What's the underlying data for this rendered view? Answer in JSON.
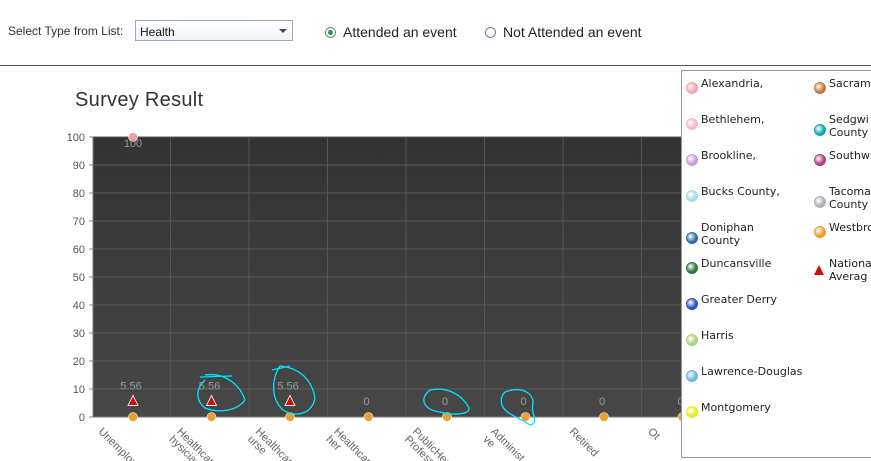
{
  "controls": {
    "select_label": "Select Type from List:",
    "select_value": "Health",
    "radio_attended": "Attended an event",
    "radio_not_attended": "Not Attended an event"
  },
  "chart_data": {
    "type": "scatter",
    "title": "Survey Result",
    "ylim": [
      0,
      100
    ],
    "yticks": [
      0,
      10,
      20,
      30,
      40,
      50,
      60,
      70,
      80,
      90,
      100
    ],
    "categories": [
      "Unemploye",
      "Healthcare Physician",
      "Healthcare Nurse",
      "Healthcare Other",
      "Public Health Professi",
      "Administrative",
      "Retired",
      "Ot"
    ],
    "category_label_lines": [
      [
        "Unemploye"
      ],
      [
        "Healthcar",
        "hysician"
      ],
      [
        "Healthcare",
        "urse"
      ],
      [
        "Healthcare",
        "her"
      ],
      [
        "PublicHeal",
        "Professio"
      ],
      [
        "Administ",
        "ve"
      ],
      [
        "Retired"
      ],
      [
        "Ot"
      ]
    ],
    "data_labels": [
      "5.56",
      "5.56",
      "5.56",
      "0",
      "0",
      "0",
      "0",
      "0"
    ],
    "top_label": "100",
    "series": [
      {
        "name": "National Average",
        "marker": "triangle",
        "color": "#cc1111",
        "values": [
          5.56,
          5.56,
          5.56,
          null,
          null,
          null,
          null,
          null
        ]
      },
      {
        "name": "Westbro",
        "marker": "circle",
        "color": "#e8a030",
        "values": [
          0,
          0,
          0,
          0,
          0,
          0,
          0,
          0
        ]
      },
      {
        "name": "Alexandria,",
        "marker": "circle",
        "color": "#f4a0a8",
        "values": [
          100,
          null,
          null,
          null,
          null,
          null,
          null,
          null
        ]
      }
    ],
    "legend_placement": "right",
    "grid": true
  },
  "legend": {
    "col1": [
      {
        "label": "Alexandria,",
        "color": "#f4a6ad"
      },
      {
        "label": "Bethlehem,",
        "color": "#f2b8cc"
      },
      {
        "label": "Brookline,",
        "color": "#c99be0"
      },
      {
        "label": "Bucks County,",
        "color": "#a9dbe8"
      },
      {
        "label": "Doniphan\nCounty",
        "color": "#2f6ea8"
      },
      {
        "label": "Duncansville",
        "color": "#2a7a3a"
      },
      {
        "label": "Greater Derry",
        "color": "#2a55c8"
      },
      {
        "label": "Harris",
        "color": "#a8d67a"
      },
      {
        "label": "Lawrence-Douglas",
        "color": "#69b8e0"
      },
      {
        "label": "Montgomery",
        "color": "#e8ee22"
      }
    ],
    "col2": [
      {
        "label": "Sacram",
        "color": "#c07a40"
      },
      {
        "label": "Sedgwi\nCounty",
        "color": "#11aab0"
      },
      {
        "label": "Southw",
        "color": "#b04080"
      },
      {
        "label": "Tacoma\nCounty",
        "color": "#b0b0b8"
      },
      {
        "label": "Westbro",
        "color": "#e8a030"
      },
      {
        "label": "Nationa\nAverag",
        "color": "#cc1111",
        "marker": "triangle"
      }
    ]
  }
}
